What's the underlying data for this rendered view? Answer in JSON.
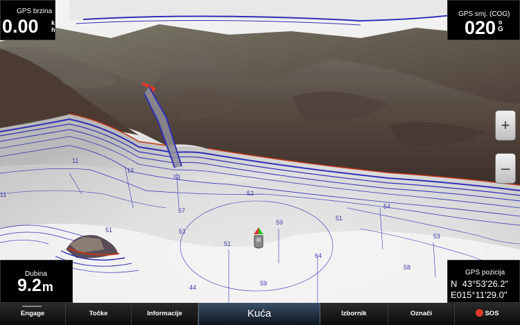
{
  "databoxes": {
    "speed": {
      "label": "GPS brzina",
      "value": "0.00",
      "unit_top": "k",
      "unit_bottom": "h"
    },
    "cog": {
      "label": "GPS smj. (COG)",
      "value": "020",
      "unit_top": "o",
      "unit_bottom": "G"
    },
    "depth": {
      "label": "Dubina",
      "value": "9.2",
      "unit": "m"
    },
    "position": {
      "label": "GPS pozicija",
      "lat": "N  43°53'26.2\"",
      "lon": "E015°11'29.0\""
    }
  },
  "zoom": {
    "in_label": "+",
    "out_label": "–"
  },
  "depth_labels": [
    "57",
    "52",
    "59",
    "51",
    "54",
    "51",
    "64",
    "59",
    "44",
    "58",
    "53",
    "53",
    "11",
    "13",
    "11",
    "51",
    "51"
  ],
  "bottom_bar": {
    "engage": "Engage",
    "tocke": "Točke",
    "informacije": "Informacije",
    "home": "Kuća",
    "izbornik": "Izbornik",
    "oznaci": "Označi",
    "sos": "SOS"
  },
  "colors": {
    "contour": "#2f2fb8",
    "shore_red": "#c23616",
    "accent": "#3a4f66"
  }
}
